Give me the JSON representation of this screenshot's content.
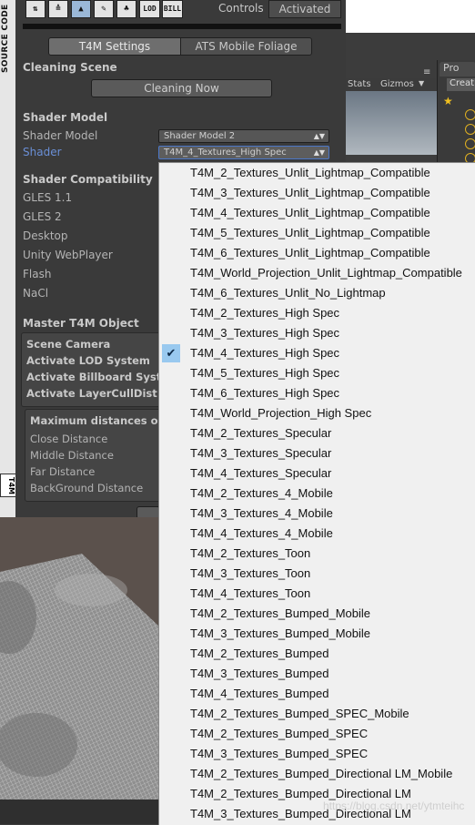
{
  "left_strip": {
    "vertical_text": "SOURCE CODE",
    "logo_text": "T4M"
  },
  "toolbar": {
    "icons": [
      "paint-icon",
      "layers-icon",
      "brush-icon",
      "pencil-icon",
      "tree-icon",
      "lod-icon",
      "bill-icon"
    ],
    "lod_label": "LOD",
    "bill_label": "BILL",
    "controls_label": "Controls",
    "activated_button": "Activated"
  },
  "tabs": [
    "T4M Settings",
    "ATS Mobile Foliage"
  ],
  "cleaning": {
    "header": "Cleaning Scene",
    "button": "Cleaning Now"
  },
  "shader_model": {
    "header": "Shader Model",
    "model_label": "Shader Model",
    "model_value": "Shader Model 2",
    "shader_label": "Shader",
    "shader_value": "T4M_4_Textures_High Spec"
  },
  "compatibility": {
    "header": "Shader Compatibility",
    "items": [
      "GLES 1.1",
      "GLES 2",
      "Desktop",
      "Unity WebPlayer",
      "Flash",
      "NaCl"
    ]
  },
  "master": {
    "header": "Master T4M Object",
    "items": [
      "Scene Camera",
      "Activate LOD System",
      "Activate Billboard Syst",
      "Activate LayerCullDist"
    ]
  },
  "distances": {
    "header": "Maximum distances o",
    "items": [
      "Close Distance",
      "Middle Distance",
      "Far Distance",
      "BackGround Distance"
    ]
  },
  "scene": {
    "stats": "Stats",
    "gizmos": "Gizmos",
    "hierarchy_tab": "Pro",
    "create_button": "Creat"
  },
  "dropdown": {
    "selected_index": 9,
    "items": [
      "T4M_2_Textures_Unlit_Lightmap_Compatible",
      "T4M_3_Textures_Unlit_Lightmap_Compatible",
      "T4M_4_Textures_Unlit_Lightmap_Compatible",
      "T4M_5_Textures_Unlit_Lightmap_Compatible",
      "T4M_6_Textures_Unlit_Lightmap_Compatible",
      "T4M_World_Projection_Unlit_Lightmap_Compatible",
      "T4M_6_Textures_Unlit_No_Lightmap",
      "T4M_2_Textures_High Spec",
      "T4M_3_Textures_High Spec",
      "T4M_4_Textures_High Spec",
      "T4M_5_Textures_High Spec",
      "T4M_6_Textures_High Spec",
      "T4M_World_Projection_High Spec",
      "T4M_2_Textures_Specular",
      "T4M_3_Textures_Specular",
      "T4M_4_Textures_Specular",
      "T4M_2_Textures_4_Mobile",
      "T4M_3_Textures_4_Mobile",
      "T4M_4_Textures_4_Mobile",
      "T4M_2_Textures_Toon",
      "T4M_3_Textures_Toon",
      "T4M_4_Textures_Toon",
      "T4M_2_Textures_Bumped_Mobile",
      "T4M_3_Textures_Bumped_Mobile",
      "T4M_2_Textures_Bumped",
      "T4M_3_Textures_Bumped",
      "T4M_4_Textures_Bumped",
      "T4M_2_Textures_Bumped_SPEC_Mobile",
      "T4M_2_Textures_Bumped_SPEC",
      "T4M_3_Textures_Bumped_SPEC",
      "T4M_2_Textures_Bumped_Directional LM_Mobile",
      "T4M_2_Textures_Bumped_Directional LM",
      "T4M_3_Textures_Bumped_Directional LM"
    ]
  },
  "watermark": "https://blog.csdn.net/ytmteihc"
}
